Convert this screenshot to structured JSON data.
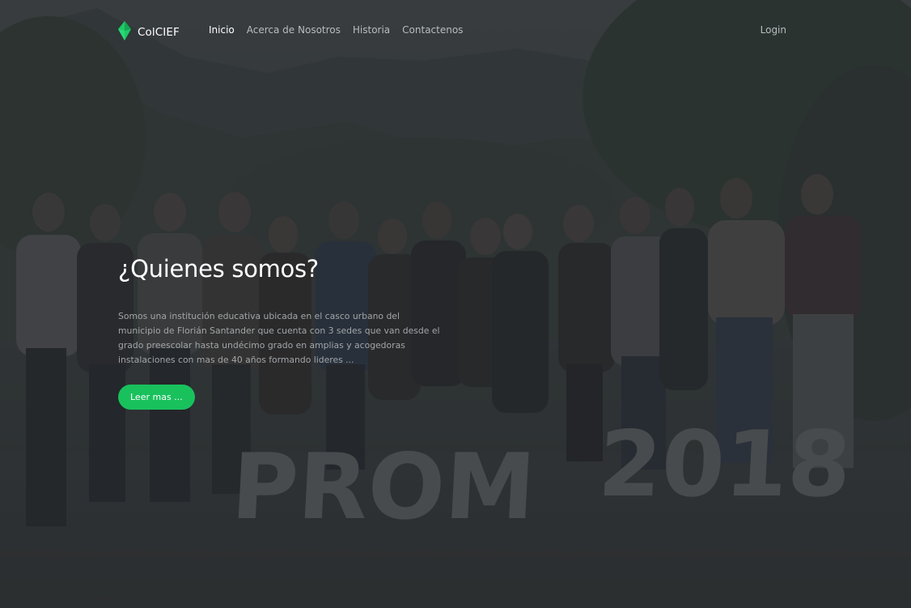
{
  "brand": {
    "name": "ColCIEF",
    "logo_icon": "green-diamond-logo-icon",
    "accent": "#19c15d"
  },
  "nav": {
    "links": [
      {
        "label": "Inicio",
        "active": true
      },
      {
        "label": "Acerca de Nosotros",
        "active": false
      },
      {
        "label": "Historia",
        "active": false
      },
      {
        "label": "Contactenos",
        "active": false
      }
    ],
    "login": "Login"
  },
  "hero": {
    "title": "¿Quienes somos?",
    "description": "Somos una institución educativa ubicada en el casco urbano del municipio de Florián Santander que cuenta con 3 sedes que van desde el grado preescolar hasta undécimo grado en amplias y acogedoras instalaciones con mas de 40 años formando lideres ...",
    "cta_label": "Leer mas ...",
    "background_sign_text": "PROM 2018"
  }
}
